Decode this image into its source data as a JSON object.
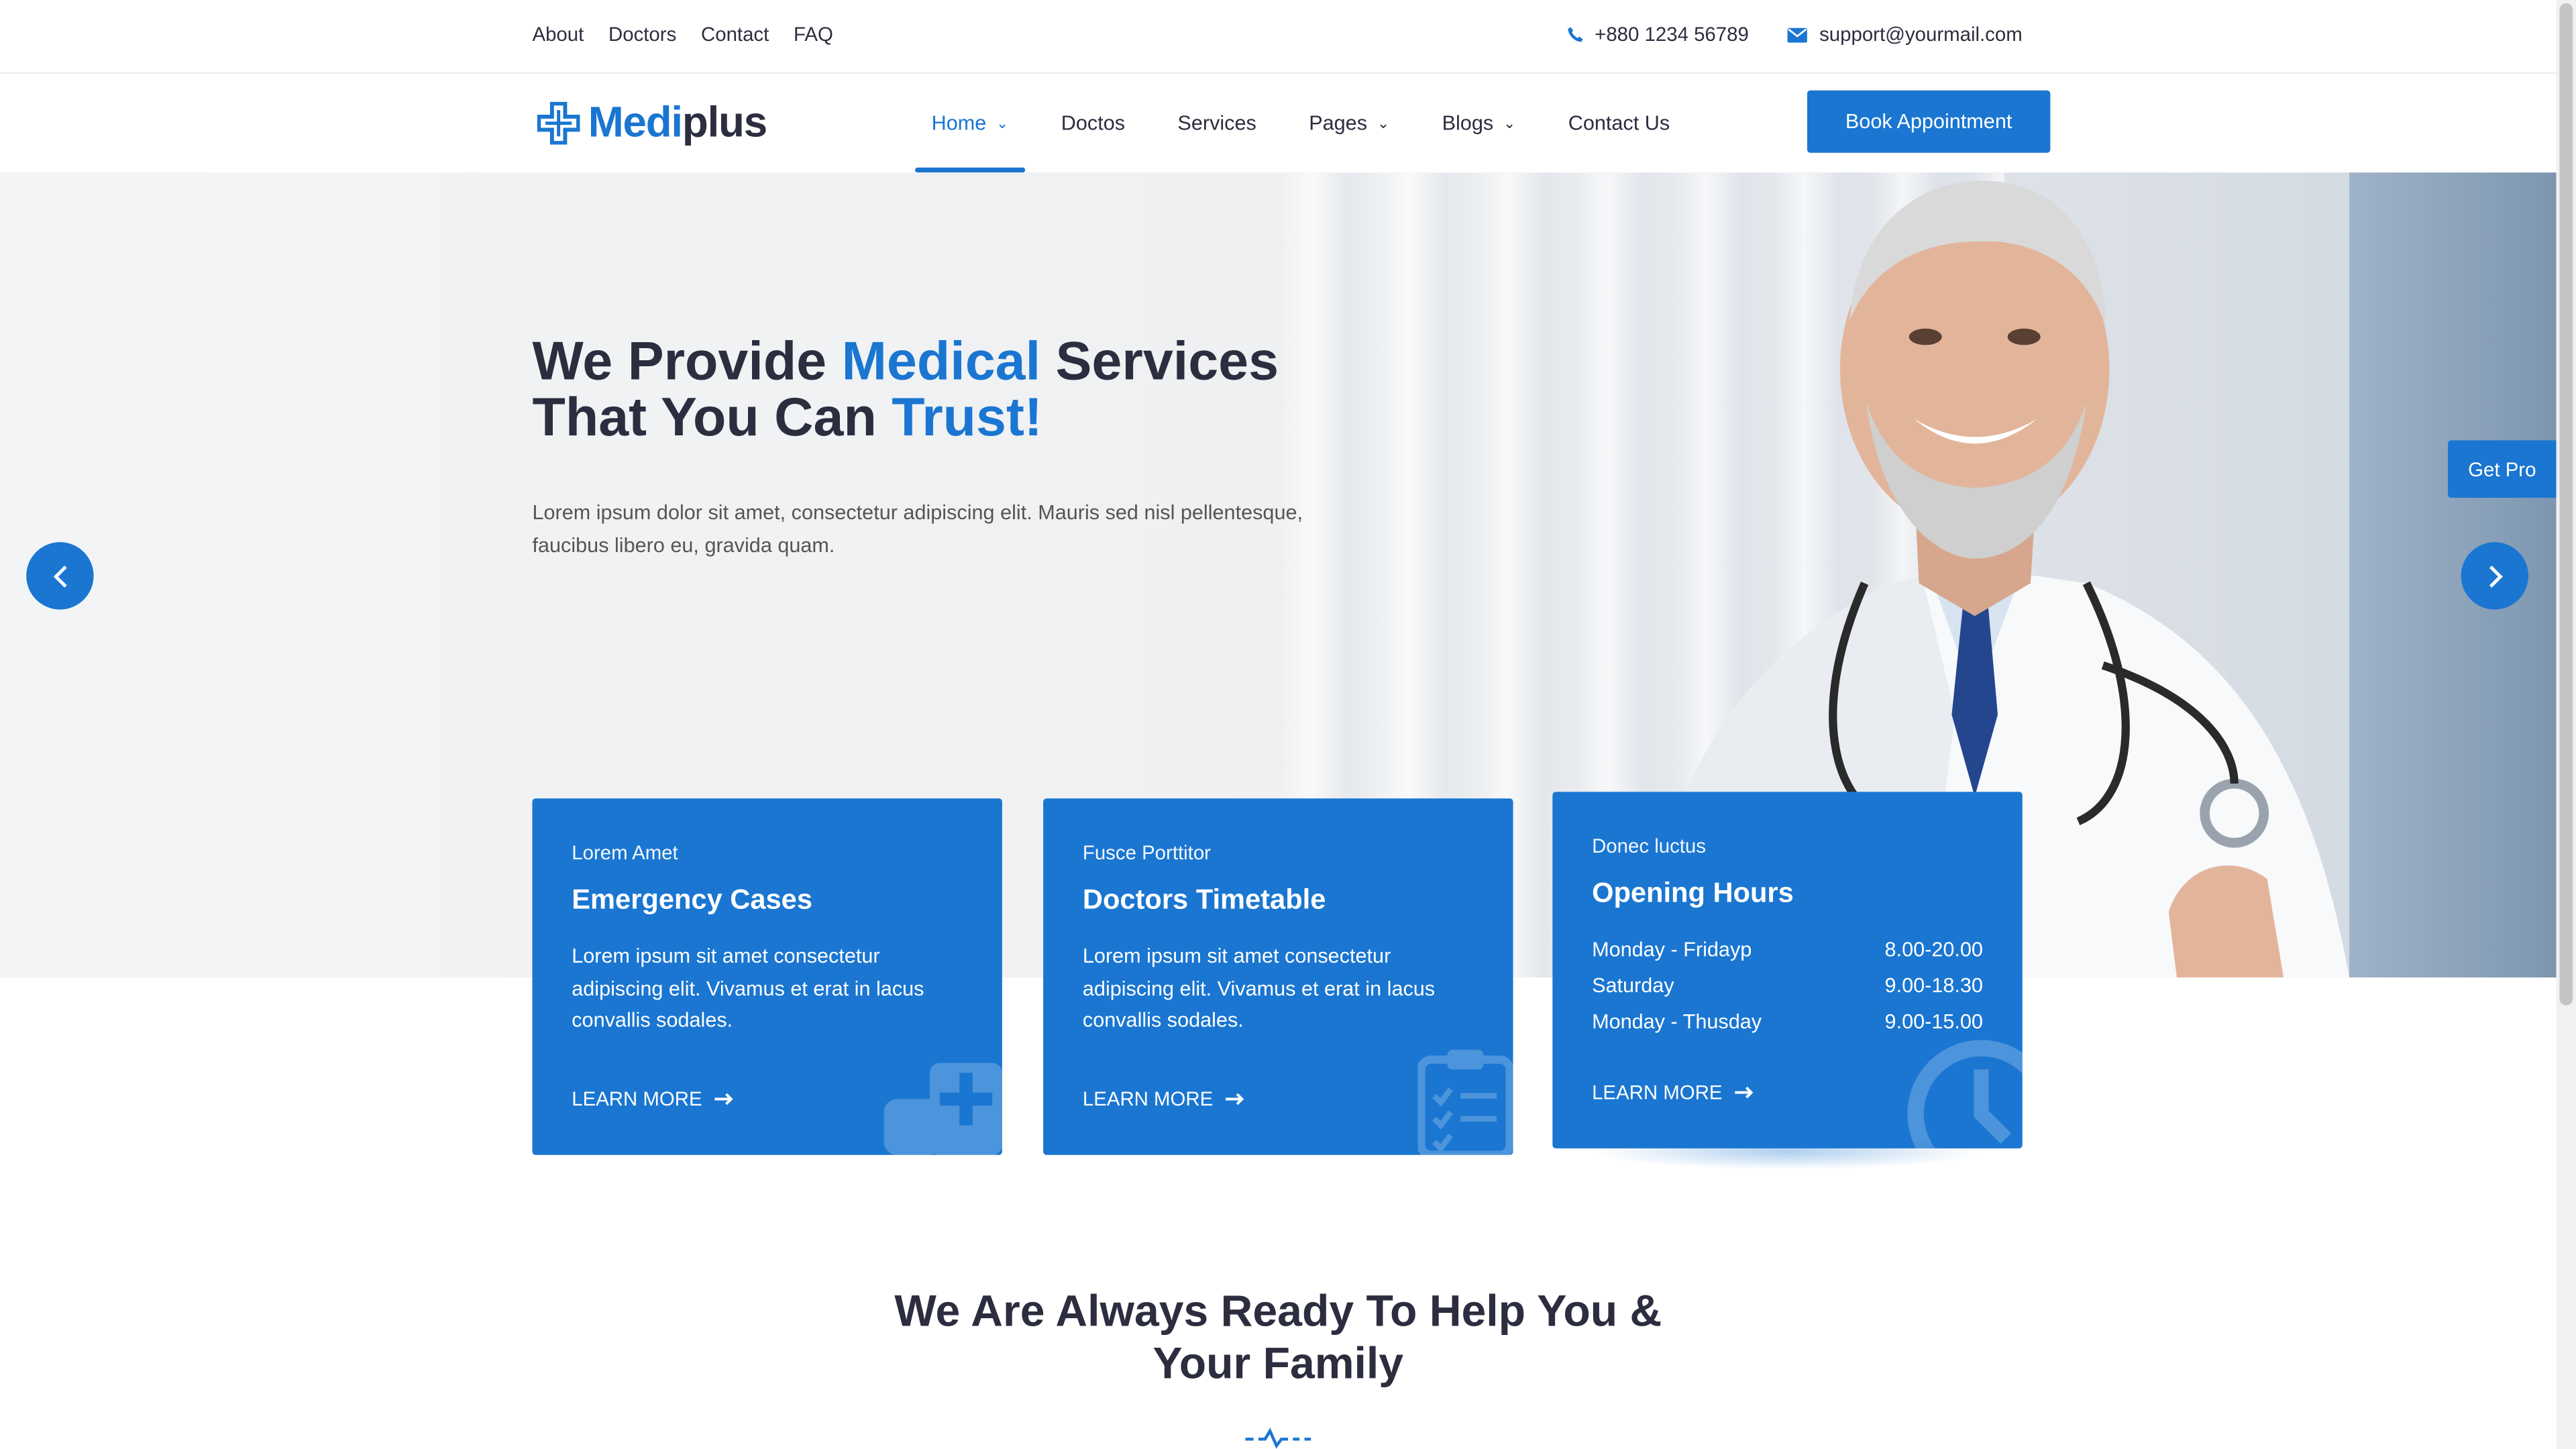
{
  "topbar": {
    "links": [
      "About",
      "Doctors",
      "Contact",
      "FAQ"
    ],
    "phone": "+880 1234 56789",
    "email": "support@yourmail.com"
  },
  "header": {
    "logo_part1": "Medi",
    "logo_part2": "plus",
    "nav": [
      "Home",
      "Doctos",
      "Services",
      "Pages",
      "Blogs",
      "Contact Us"
    ],
    "cta": "Book Appointment"
  },
  "hero": {
    "title_1": "We Provide ",
    "title_2": "Medical",
    "title_3": " Services",
    "title_4": "That You Can ",
    "title_5": "Trust!",
    "lead": "Lorem ipsum dolor sit amet, consectetur adipiscing elit. Mauris sed nisl pellentesque, faucibus libero eu, gravida quam.",
    "get_pro": "Get Pro"
  },
  "cards": [
    {
      "small": "Lorem Amet",
      "title": "Emergency Cases",
      "body": "Lorem ipsum sit amet consectetur adipiscing elit. Vivamus et erat in lacus convallis sodales.",
      "link": "LEARN MORE"
    },
    {
      "small": "Fusce Porttitor",
      "title": "Doctors Timetable",
      "body": "Lorem ipsum sit amet consectetur adipiscing elit. Vivamus et erat in lacus convallis sodales.",
      "link": "LEARN MORE"
    },
    {
      "small": "Donec luctus",
      "title": "Opening Hours",
      "hours": [
        {
          "day": "Monday - Fridayp",
          "time": "8.00-20.00"
        },
        {
          "day": "Saturday",
          "time": "9.00-18.30"
        },
        {
          "day": "Monday - Thusday",
          "time": "9.00-15.00"
        }
      ],
      "link": "LEARN MORE"
    }
  ],
  "section": {
    "title_line1": "We Are Always Ready To Help You &",
    "title_line2": "Your Family"
  },
  "colors": {
    "accent": "#1a76d1",
    "text": "#2c2d3f"
  }
}
